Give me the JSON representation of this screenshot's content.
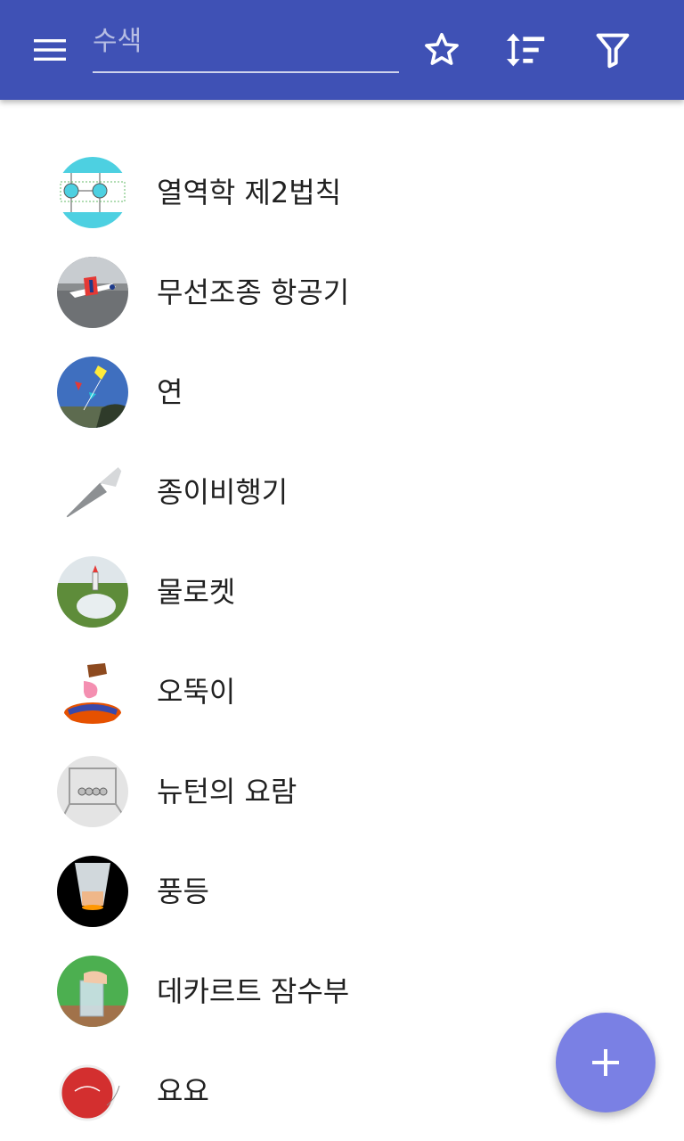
{
  "toolbar": {
    "menu_icon": "hamburger-menu-icon",
    "search_placeholder": "수색",
    "favorite_icon": "star-outline-icon",
    "sort_icon": "sort-icon",
    "filter_icon": "filter-icon"
  },
  "items": [
    {
      "label": "열역학 제2법칙"
    },
    {
      "label": "무선조종 항공기"
    },
    {
      "label": "연"
    },
    {
      "label": "종이비행기"
    },
    {
      "label": "물로켓"
    },
    {
      "label": "오뚝이"
    },
    {
      "label": "뉴턴의 요람"
    },
    {
      "label": "풍등"
    },
    {
      "label": "데카르트 잠수부"
    },
    {
      "label": "요요"
    }
  ],
  "fab": {
    "icon": "plus-icon"
  },
  "colors": {
    "appbar": "#3f51b5",
    "fab": "#7a80e4",
    "text": "#212121"
  }
}
